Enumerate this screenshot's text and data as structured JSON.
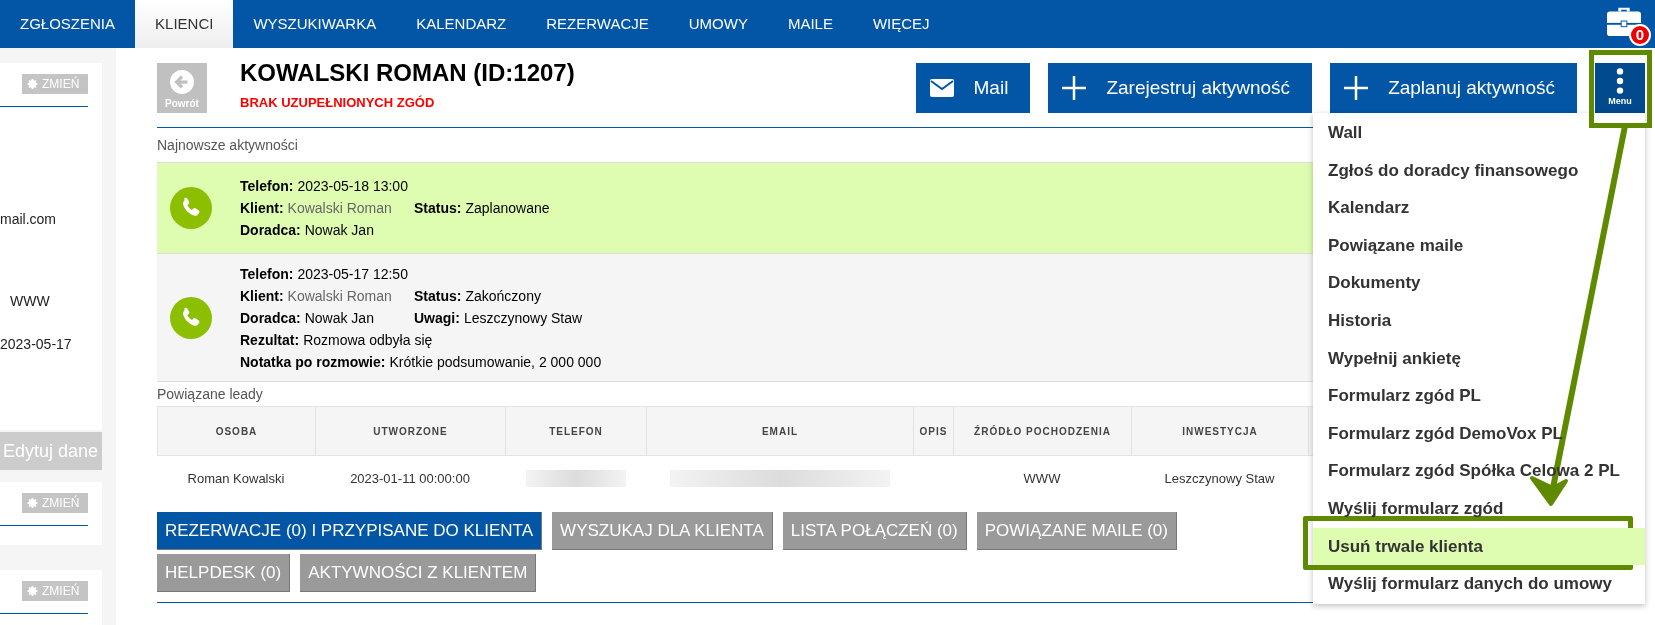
{
  "nav": {
    "tabs": [
      {
        "label": "ZGŁOSZENIA",
        "selected": false
      },
      {
        "label": "KLIENCI",
        "selected": true
      },
      {
        "label": "WYSZUKIWARKA",
        "selected": false
      },
      {
        "label": "KALENDARZ",
        "selected": false
      },
      {
        "label": "REZERWACJE",
        "selected": false
      },
      {
        "label": "UMOWY",
        "selected": false
      },
      {
        "label": "MAILE",
        "selected": false
      },
      {
        "label": "WIĘCEJ",
        "selected": false
      }
    ],
    "badge": "0"
  },
  "sidebar": {
    "sections": [
      {
        "change_button": "ZMIEŃ",
        "fields": [
          "mail.com",
          "WWW",
          "2023-05-17"
        ],
        "edit_button": "Edytuj dane"
      },
      {
        "change_button": "ZMIEŃ"
      },
      {
        "change_button": "ZMIEŃ"
      }
    ]
  },
  "header": {
    "back_button": "Powrót",
    "title": "KOWALSKI ROMAN (ID:1207)",
    "warning": "BRAK UZUPEŁNIONYCH ZGÓD",
    "actions": [
      {
        "kind": "mail",
        "label": "Mail"
      },
      {
        "kind": "add",
        "label": "Zarejestruj aktywność"
      },
      {
        "kind": "add",
        "label": "Zaplanuj aktywność"
      }
    ],
    "menu_button": {
      "label": "Menu",
      "expanded": true
    }
  },
  "activities": {
    "title": "Najnowsze aktywności",
    "items": [
      {
        "highlighted": true,
        "lines": [
          [
            {
              "label": "Telefon:",
              "value": "2023-05-18 13:00",
              "muted": false
            }
          ],
          [
            {
              "label": "Klient:",
              "value": "Kowalski Roman",
              "muted": true
            },
            {
              "label": "Status:",
              "value": "Zaplanowane",
              "muted": false
            }
          ],
          [
            {
              "label": "Doradca:",
              "value": "Nowak Jan",
              "muted": false
            }
          ]
        ]
      },
      {
        "highlighted": false,
        "lines": [
          [
            {
              "label": "Telefon:",
              "value": "2023-05-17 12:50",
              "muted": false
            }
          ],
          [
            {
              "label": "Klient:",
              "value": "Kowalski Roman",
              "muted": true
            },
            {
              "label": "Status:",
              "value": "Zakończony",
              "muted": false
            }
          ],
          [
            {
              "label": "Doradca:",
              "value": "Nowak Jan",
              "muted": false
            },
            {
              "label": "Uwagi:",
              "value": "Leszczynowy Staw",
              "muted": false
            }
          ],
          [
            {
              "label": "Rezultat:",
              "value": "Rozmowa odbyła się",
              "muted": false
            }
          ],
          [
            {
              "label": "Notatka po rozmowie:",
              "value": "Krótkie podsumowanie, 2 000 000",
              "muted": false
            }
          ]
        ]
      }
    ]
  },
  "leads": {
    "title": "Powiązane leady",
    "columns": [
      "OSOBA",
      "UTWORZONE",
      "TELEFON",
      "EMAIL",
      "OPIS",
      "ŹRÓDŁO POCHODZENIA",
      "INWESTYCJA"
    ],
    "rows": [
      {
        "cells": [
          {
            "kind": "text",
            "text": "Roman Kowalski"
          },
          {
            "kind": "text",
            "text": "2023-01-11 00:00:00"
          },
          {
            "kind": "blurred"
          },
          {
            "kind": "blurred"
          },
          {
            "kind": "empty"
          },
          {
            "kind": "text",
            "text": "WWW"
          },
          {
            "kind": "text",
            "text": "Leszczynowy Staw"
          }
        ]
      }
    ]
  },
  "client_tabs": [
    {
      "label": "REZERWACJE (0) I PRZYPISANE DO KLIENTA",
      "selected": true
    },
    {
      "label": "WYSZUKAJ DLA KLIENTA",
      "selected": false
    },
    {
      "label": "LISTA POŁĄCZEŃ (0)",
      "selected": false
    },
    {
      "label": "POWIĄZANE MAILE (0)",
      "selected": false
    },
    {
      "label": "HELPDESK (0)",
      "selected": false
    },
    {
      "label": "AKTYWNOŚCI Z KLIENTEM",
      "selected": false
    }
  ],
  "dropdown": {
    "items": [
      {
        "label": "Wall",
        "highlighted": false
      },
      {
        "label": "Zgłoś do doradcy finansowego",
        "highlighted": false
      },
      {
        "label": "Kalendarz",
        "highlighted": false
      },
      {
        "label": "Powiązane maile",
        "highlighted": false
      },
      {
        "label": "Dokumenty",
        "highlighted": false
      },
      {
        "label": "Historia",
        "highlighted": false
      },
      {
        "label": "Wypełnij ankietę",
        "highlighted": false
      },
      {
        "label": "Formularz zgód PL",
        "highlighted": false
      },
      {
        "label": "Formularz zgód DemoVox PL",
        "highlighted": false
      },
      {
        "label": "Formularz zgód Spółka Celowa 2 PL",
        "highlighted": false
      },
      {
        "label": "Wyślij formularz zgód",
        "highlighted": false
      },
      {
        "label": "Usuń trwale klienta",
        "highlighted": true
      },
      {
        "label": "Wyślij formularz danych do umowy",
        "highlighted": false
      }
    ]
  }
}
